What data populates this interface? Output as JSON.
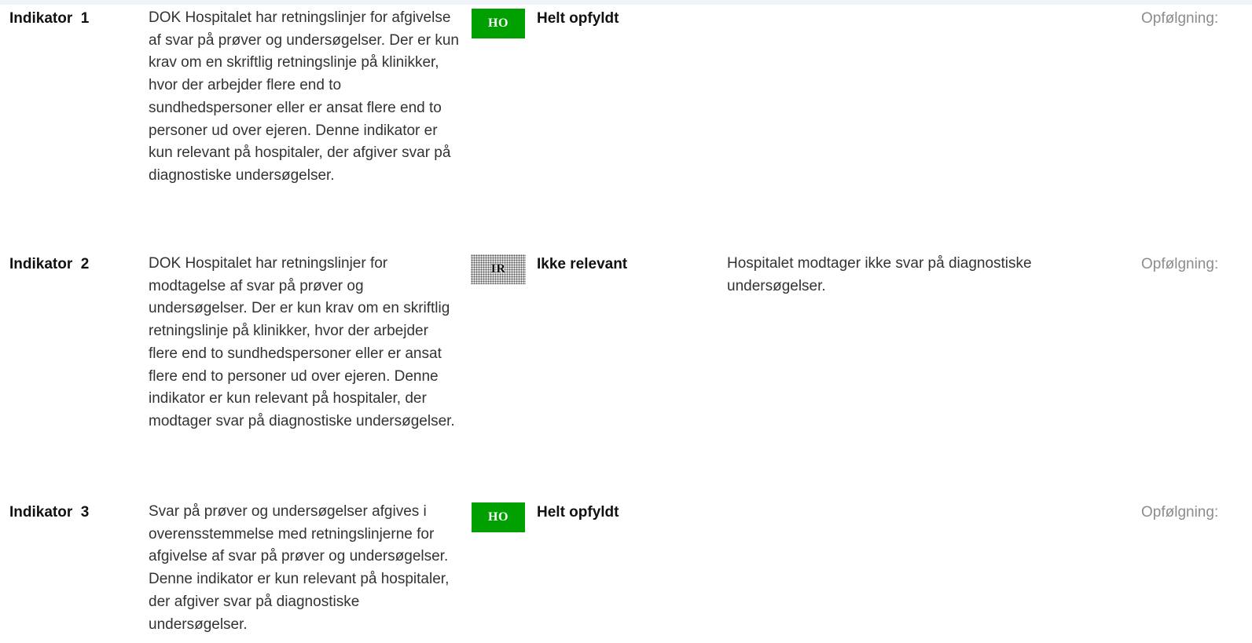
{
  "indicators": [
    {
      "label": "Indikator  1",
      "text": "DOK Hospitalet har retningslinjer for afgivelse af svar på prøver og undersøgelser.   Der er kun krav om en skriftlig retningslinje på klinikker, hvor der arbejder flere end to sundhedspersoner eller er ansat flere end to personer ud over ejeren.   Denne indikator er kun relevant på hospitaler, der afgiver svar på diagnostiske undersøgelser.",
      "badge": "HO",
      "status": "Helt opfyldt",
      "comment": "",
      "followup": "Opfølgning:"
    },
    {
      "label": "Indikator  2",
      "text": "DOK Hospitalet har retningslinjer for modtagelse af svar på prøver og undersøgelser.   Der er kun krav om en skriftlig retningslinje på klinikker, hvor der arbejder flere end to sundhedspersoner eller er ansat flere end to personer ud over ejeren.   Denne indikator er kun relevant på hospitaler, der modtager svar på diagnostiske undersøgelser.",
      "badge": "IR",
      "status": "Ikke relevant",
      "comment": "Hospitalet modtager ikke svar på diagnostiske undersøgelser.",
      "followup": "Opfølgning:"
    },
    {
      "label": "Indikator  3",
      "text": "Svar på prøver og undersøgelser afgives i overensstemmelse med retningslinjerne for afgivelse af svar på prøver og undersøgelser.   Denne indikator er kun relevant på hospitaler, der afgiver svar på diagnostiske undersøgelser.",
      "badge": "HO",
      "status": "Helt opfyldt",
      "comment": "",
      "followup": "Opfølgning:"
    }
  ],
  "colors": {
    "badge_ho_background": "#00a000",
    "badge_ho_text": "#ffffff",
    "followup_text": "#8c8c8c"
  }
}
